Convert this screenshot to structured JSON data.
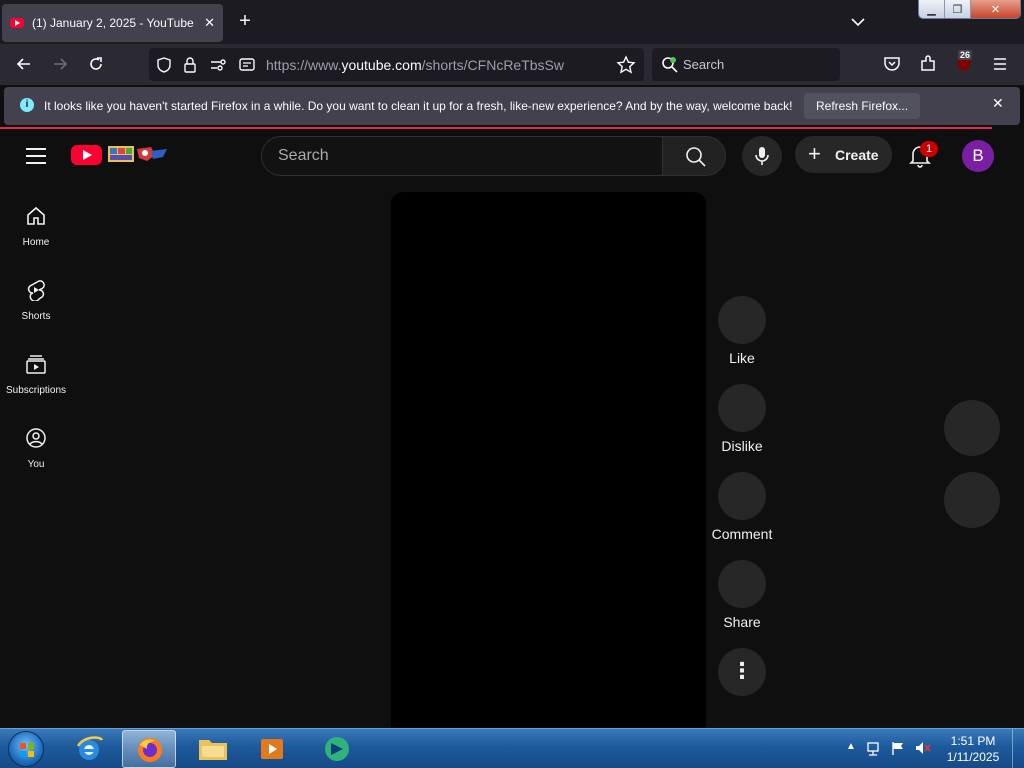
{
  "browser": {
    "tab": {
      "title": "(1) January 2, 2025 - YouTube",
      "close_icon": "close-icon"
    },
    "url_prefix": "https://www.",
    "url_domain": "youtube.com",
    "url_path": "/shorts/CFNcReTbsSw",
    "search_label": "Search",
    "extensions_badge": "26",
    "notification": {
      "message": "It looks like you haven't started Firefox in a while. Do you want to clean it up for a fresh, like-new experience? And by the way, welcome back!",
      "button": "Refresh Firefox...",
      "info_icon": "i"
    }
  },
  "youtube": {
    "search_placeholder": "Search",
    "create_label": "Create",
    "notification_count": "1",
    "avatar_letter": "B",
    "sidebar": [
      {
        "label": "Home",
        "icon": "home-icon"
      },
      {
        "label": "Shorts",
        "icon": "shorts-icon"
      },
      {
        "label": "Subscriptions",
        "icon": "subscriptions-icon"
      },
      {
        "label": "You",
        "icon": "you-icon"
      }
    ],
    "actions": [
      {
        "label": "Like"
      },
      {
        "label": "Dislike"
      },
      {
        "label": "Comment"
      },
      {
        "label": "Share"
      }
    ],
    "more_glyph": "⋮"
  },
  "taskbar": {
    "time": "1:51 PM",
    "date": "1/11/2025"
  },
  "colors": {
    "yt_red": "#ff0033",
    "firefox_accent": "#e22850",
    "avatar_bg": "#7b1fa2"
  }
}
